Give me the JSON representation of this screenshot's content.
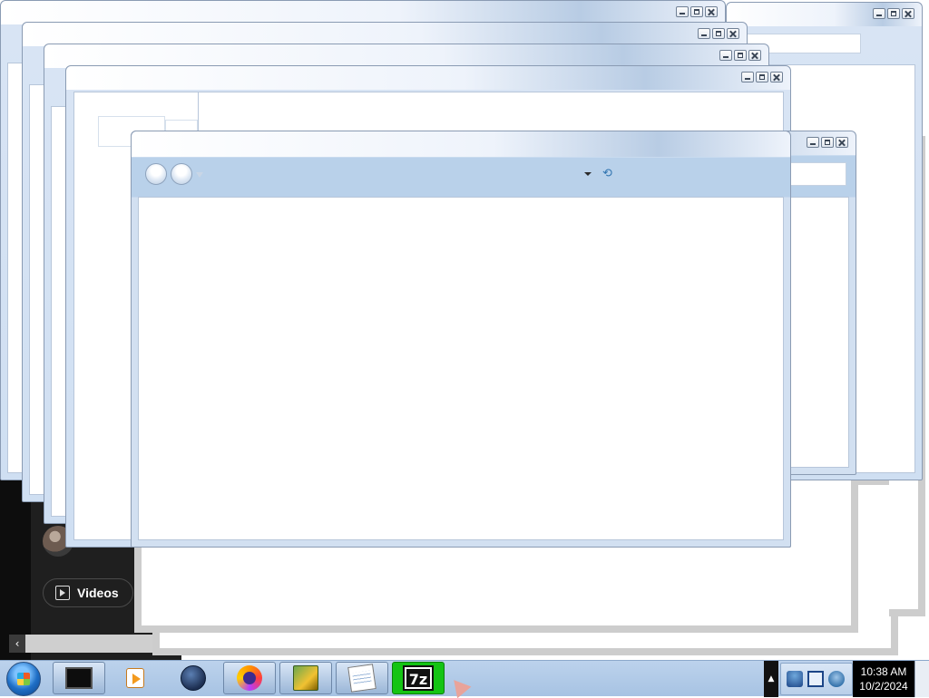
{
  "screen": {
    "background": "#ffffff"
  },
  "background_app": {
    "chip_label": "Videos",
    "hscroll_left_glyph": "‹"
  },
  "windows": [
    {
      "id": "window-1",
      "title": "",
      "search_placeholder": ""
    },
    {
      "id": "window-2",
      "title": "",
      "search_placeholder": ""
    },
    {
      "id": "window-3",
      "title": "",
      "search_placeholder": ""
    },
    {
      "id": "window-4",
      "title": "",
      "search_placeholder": ""
    },
    {
      "id": "window-5",
      "title": "",
      "search_placeholder": ""
    },
    {
      "id": "window-front",
      "title": "",
      "search_placeholder": ""
    }
  ],
  "caption_icons": [
    "minimize-icon",
    "maximize-icon",
    "close-icon"
  ],
  "taskbar": {
    "start_icon": "windows-start-orb-icon",
    "items": [
      {
        "name": "command-prompt",
        "icon": "terminal-icon",
        "active": true
      },
      {
        "name": "media-player",
        "icon": "media-player-icon",
        "active": false
      },
      {
        "name": "globe-app",
        "icon": "globe-icon",
        "active": false
      },
      {
        "name": "firefox",
        "icon": "firefox-icon",
        "active": false
      },
      {
        "name": "game",
        "icon": "game-icon",
        "active": false
      },
      {
        "name": "notepad",
        "icon": "notepad-icon",
        "active": false
      },
      {
        "name": "7zip",
        "icon": "7zip-icon",
        "label": "7z",
        "active": false
      }
    ],
    "tray_expand_glyph": "▲",
    "tray_icons": [
      "network-icon",
      "display-icon",
      "volume-icon"
    ],
    "clock": {
      "time": "10:38 AM",
      "date": "10/2/2024"
    }
  },
  "colors": {
    "taskbar": "#a7c3e3",
    "window_frame": "#cfdff2",
    "7zip_bg": "#14c414"
  }
}
